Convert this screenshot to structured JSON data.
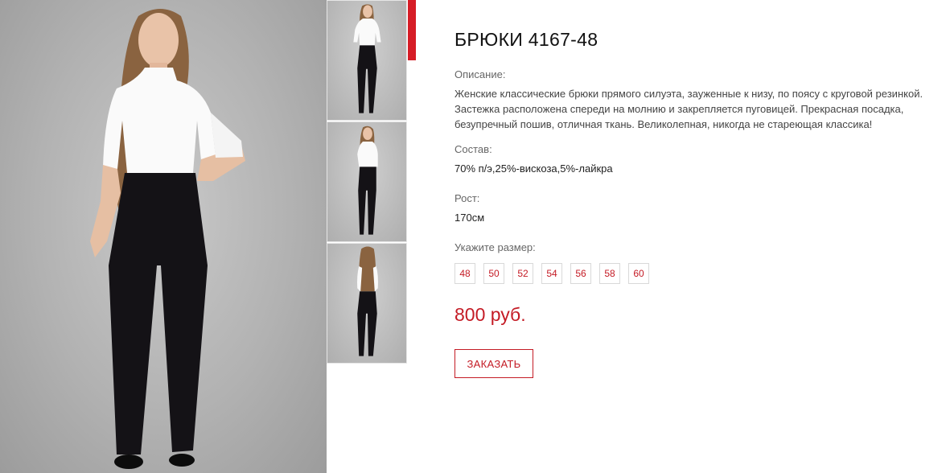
{
  "product": {
    "title": "БРЮКИ 4167-48",
    "description_label": "Описание:",
    "description": "Женские классические брюки прямого силуэта, зауженные к низу, по поясу с круговой резинкой. Застежка расположена спереди на молнию и закрепляется пуговицей. Прекрасная посадка, безупречный пошив, отличная ткань. Великолепная, никогда не стареющая классика!",
    "composition_label": "Состав:",
    "composition": "70% п/э,25%-вискоза,5%-лайкра",
    "height_label": "Рост:",
    "height": "170см",
    "size_label": "Укажите размер:",
    "sizes": [
      "48",
      "50",
      "52",
      "54",
      "56",
      "58",
      "60"
    ],
    "price": "800 руб.",
    "order_label": "ЗАКАЗАТЬ"
  },
  "colors": {
    "accent": "#d61c26",
    "price": "#c41b25",
    "photo_background": "#b2b2b2",
    "top": "#ffffff",
    "trousers": "#141216"
  }
}
